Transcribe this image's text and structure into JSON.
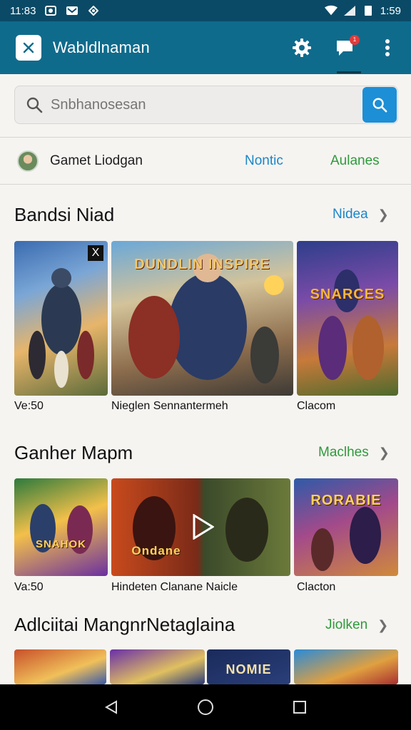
{
  "status_bar": {
    "time_left": "11:83",
    "time_right": "1:59"
  },
  "app_bar": {
    "title": "Wabldlnaman",
    "notification_count": "1"
  },
  "search": {
    "placeholder": "Snbhanosesan"
  },
  "profile": {
    "name": "Gamet Liodgan",
    "link_1": "Nontic",
    "link_2": "Aulanes"
  },
  "sections": [
    {
      "title": "Bandsi Niad",
      "link": "Nidea",
      "link_color": "#1c86c8",
      "tiles": [
        {
          "label": "Ve:50",
          "art_text": "",
          "badge": "X"
        },
        {
          "label": "Nieglen Sennantermeh",
          "art_text": "DUNDLIN INSPIRE",
          "badge": ""
        },
        {
          "label": "Clacom",
          "art_text": "SNARCES",
          "badge": ""
        }
      ]
    },
    {
      "title": "Ganher Mapm",
      "link": "Maclhes",
      "link_color": "#2f9a3c",
      "tiles": [
        {
          "label": "Va:50",
          "art_text": "SNAHOK",
          "badge": ""
        },
        {
          "label": "Hindeten Clanane Naicle",
          "art_text": "Ondane",
          "badge": ""
        },
        {
          "label": "Clacton",
          "art_text": "RORABIE",
          "badge": ""
        }
      ]
    },
    {
      "title": "Adlciitai MangnrNetaglaina",
      "link": "Jiolken",
      "link_color": "#2f9a3c",
      "tiles": [
        {
          "label": "",
          "art_text": "",
          "badge": ""
        },
        {
          "label": "",
          "art_text": "",
          "badge": ""
        },
        {
          "label": "",
          "art_text": "NOMIE",
          "badge": ""
        },
        {
          "label": "",
          "art_text": "",
          "badge": ""
        }
      ]
    }
  ]
}
